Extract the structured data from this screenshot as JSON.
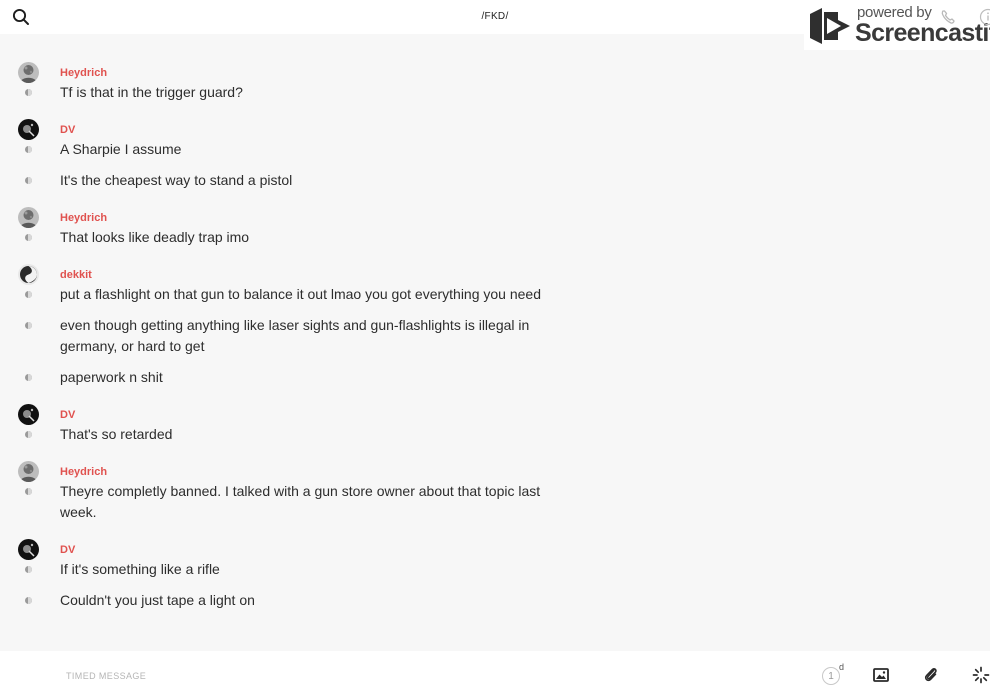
{
  "header": {
    "channel_title": "/FKD/"
  },
  "watermark": {
    "powered_text": "powered by",
    "brand_text": "Screencastify"
  },
  "groups": [
    {
      "user": "Heydrich",
      "avatar": "heydrich",
      "messages": [
        "Tf is that in the trigger guard?"
      ]
    },
    {
      "user": "DV",
      "avatar": "dv",
      "messages": [
        "A Sharpie I assume",
        "It's the cheapest way to stand a pistol"
      ]
    },
    {
      "user": "Heydrich",
      "avatar": "heydrich",
      "messages": [
        "That looks like deadly trap imo"
      ]
    },
    {
      "user": "dekkit",
      "avatar": "dekkit",
      "messages": [
        "put a flashlight on that gun to balance it out lmao you got everything you need",
        "even though getting anything like laser sights and gun-flashlights is illegal in germany, or hard to get",
        "paperwork n shit"
      ]
    },
    {
      "user": "DV",
      "avatar": "dv",
      "messages": [
        "That's so retarded"
      ]
    },
    {
      "user": "Heydrich",
      "avatar": "heydrich",
      "messages": [
        "Theyre completly banned. I talked with a gun store owner about that topic last week."
      ]
    },
    {
      "user": "DV",
      "avatar": "dv",
      "messages": [
        "If it's something like a rifle",
        "Couldn't you just tape a light on"
      ]
    }
  ],
  "composer": {
    "placeholder": "TIMED MESSAGE",
    "timer_value": "1",
    "timer_unit": "d"
  },
  "icons": [
    "search-icon",
    "phone-icon",
    "info-icon",
    "image-icon",
    "paperclip-icon",
    "loading-spinner-icon",
    "screencastify-logo"
  ],
  "colors": {
    "username": "#e0524f",
    "background": "#f7f7f7",
    "bar": "#ffffff"
  }
}
